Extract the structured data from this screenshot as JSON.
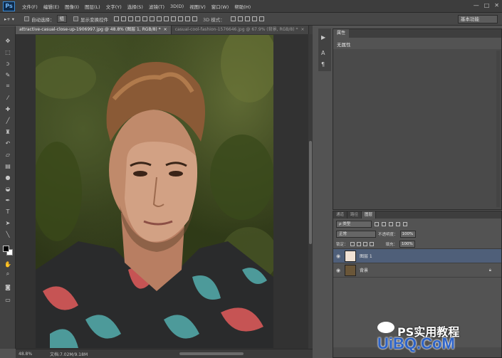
{
  "menubar": {
    "logo": "Ps",
    "items": [
      "文件(F)",
      "编辑(E)",
      "图像(I)",
      "图层(L)",
      "文字(Y)",
      "选择(S)",
      "滤镜(T)",
      "3D(D)",
      "视图(V)",
      "窗口(W)",
      "帮助(H)"
    ],
    "window_controls": [
      "—",
      "□",
      "✕"
    ]
  },
  "options_bar": {
    "tool_glyph": "▸+ ▾",
    "auto_select_label": "自动选择：",
    "auto_select_value": "组",
    "show_transform_label": "显示变换控件",
    "mode_3d_label": "3D 模式：",
    "workspace": "基本功能"
  },
  "tabs": [
    {
      "label": "attractive-casual-close-up-1906997.jpg @ 48.8% (图层 1, RGB/8) *",
      "close": "×"
    },
    {
      "label": "casual-cool-fashion-1576646.jpg @ 67.9% (背景, RGB/8) *",
      "close": "×"
    }
  ],
  "status": {
    "zoom": "48.8%",
    "doc": "文档:7.02M/9.18M"
  },
  "properties_panel": {
    "tab": "属性",
    "content": "无属性"
  },
  "layers_panel": {
    "tabs": [
      "通道",
      "路径",
      "图层"
    ],
    "filter_type": "ρ 类型",
    "blend_mode": "正常",
    "opacity_label": "不透明度：",
    "opacity_value": "100%",
    "lock_label": "锁定：",
    "fill_label": "填充：",
    "fill_value": "100%",
    "layers": [
      {
        "name": "图层 1",
        "selected": true
      },
      {
        "name": "背景",
        "selected": false
      }
    ]
  },
  "watermark": {
    "top": "PS实用教程",
    "bottom": "UiBQ.CoM"
  },
  "colors": {
    "ui_dark": "#3d3d3d",
    "panel": "#535353",
    "selection": "#4f5f79",
    "watermark_blue": "#2d63c8"
  },
  "icons": {
    "tools": [
      "move-icon",
      "marquee-icon",
      "lasso-icon",
      "quick-select-icon",
      "crop-icon",
      "eyedropper-icon",
      "healing-icon",
      "brush-icon",
      "stamp-icon",
      "history-brush-icon",
      "eraser-icon",
      "gradient-icon",
      "blur-icon",
      "dodge-icon",
      "pen-icon",
      "type-icon",
      "path-select-icon",
      "shape-icon",
      "hand-icon",
      "zoom-icon"
    ]
  }
}
